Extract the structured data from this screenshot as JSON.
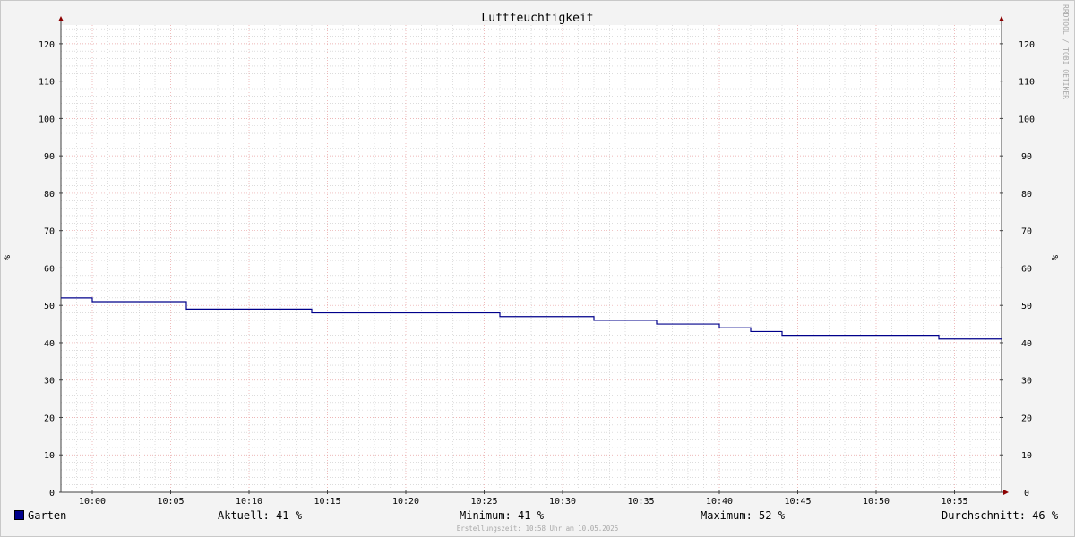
{
  "chart_data": {
    "type": "line",
    "title": "Luftfeuchtigkeit",
    "ylabel": "%",
    "ylabel_right": "%",
    "ylim": [
      0,
      125
    ],
    "yticks": [
      0,
      10,
      20,
      30,
      40,
      50,
      60,
      70,
      80,
      90,
      100,
      110,
      120
    ],
    "xlim": [
      "09:58",
      "10:58"
    ],
    "xticks": [
      "10:00",
      "10:05",
      "10:10",
      "10:15",
      "10:20",
      "10:25",
      "10:30",
      "10:35",
      "10:40",
      "10:45",
      "10:50",
      "10:55"
    ],
    "grid": true,
    "series": [
      {
        "name": "Garten",
        "color": "#00008b",
        "step": true,
        "x": [
          "09:58",
          "10:00",
          "10:06",
          "10:14",
          "10:26",
          "10:32",
          "10:36",
          "10:40",
          "10:42",
          "10:44",
          "10:54",
          "10:58"
        ],
        "y": [
          52,
          51,
          49,
          48,
          47,
          46,
          45,
          44,
          43,
          42,
          41,
          41
        ]
      }
    ]
  },
  "legend": {
    "series_name": "Garten",
    "current_label": "Aktuell:",
    "current_value": "41 %",
    "min_label": "Minimum:",
    "min_value": "41 %",
    "max_label": "Maximum:",
    "max_value": "52 %",
    "avg_label": "Durchschnitt:",
    "avg_value": "46 %"
  },
  "watermark": "RRDTOOL / TOBI OETIKER",
  "footer": "Erstellungszeit: 10:58 Uhr am 10.05.2025",
  "colors": {
    "background": "#f3f3f3",
    "plot_area": "#ffffff",
    "major_grid": "#e8a0a0",
    "minor_grid": "#c8c8c8",
    "axis": "#404040",
    "arrow": "#8b0000",
    "series": "#00008b"
  }
}
